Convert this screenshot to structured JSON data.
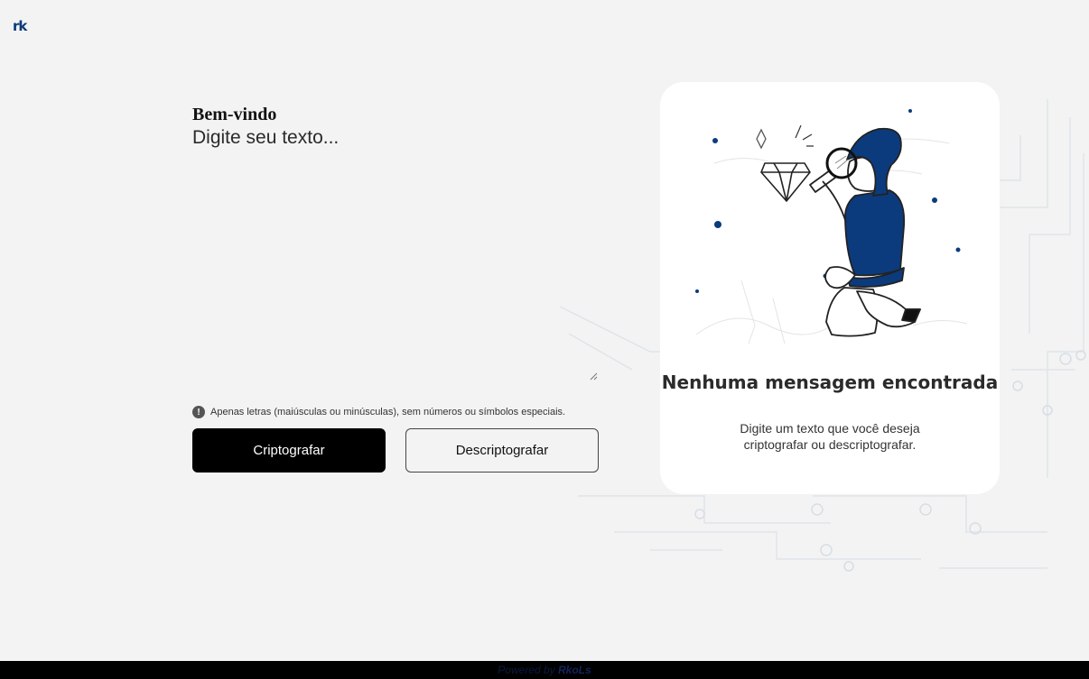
{
  "logo": {
    "text": "rk"
  },
  "form": {
    "heading": "Bem-vindo",
    "placeholder": "Digite seu texto...",
    "hint": "Apenas letras (maiúsculas ou minúsculas), sem números ou símbolos especiais.",
    "hint_icon": "exclamation-icon",
    "encrypt_label": "Criptografar",
    "decrypt_label": "Descriptografar"
  },
  "result_card": {
    "title": "Nenhuma mensagem encontrada",
    "subtitle": "Digite um texto que você deseja criptografar ou descriptografar.",
    "illustration": "person-with-magnifier-and-diamond"
  },
  "footer": {
    "prefix": "Powered by",
    "brand": "RkoLs"
  },
  "colors": {
    "background": "#f3f3f3",
    "accent": "#0a3a7a",
    "primary_button": "#000000",
    "card": "#ffffff"
  }
}
